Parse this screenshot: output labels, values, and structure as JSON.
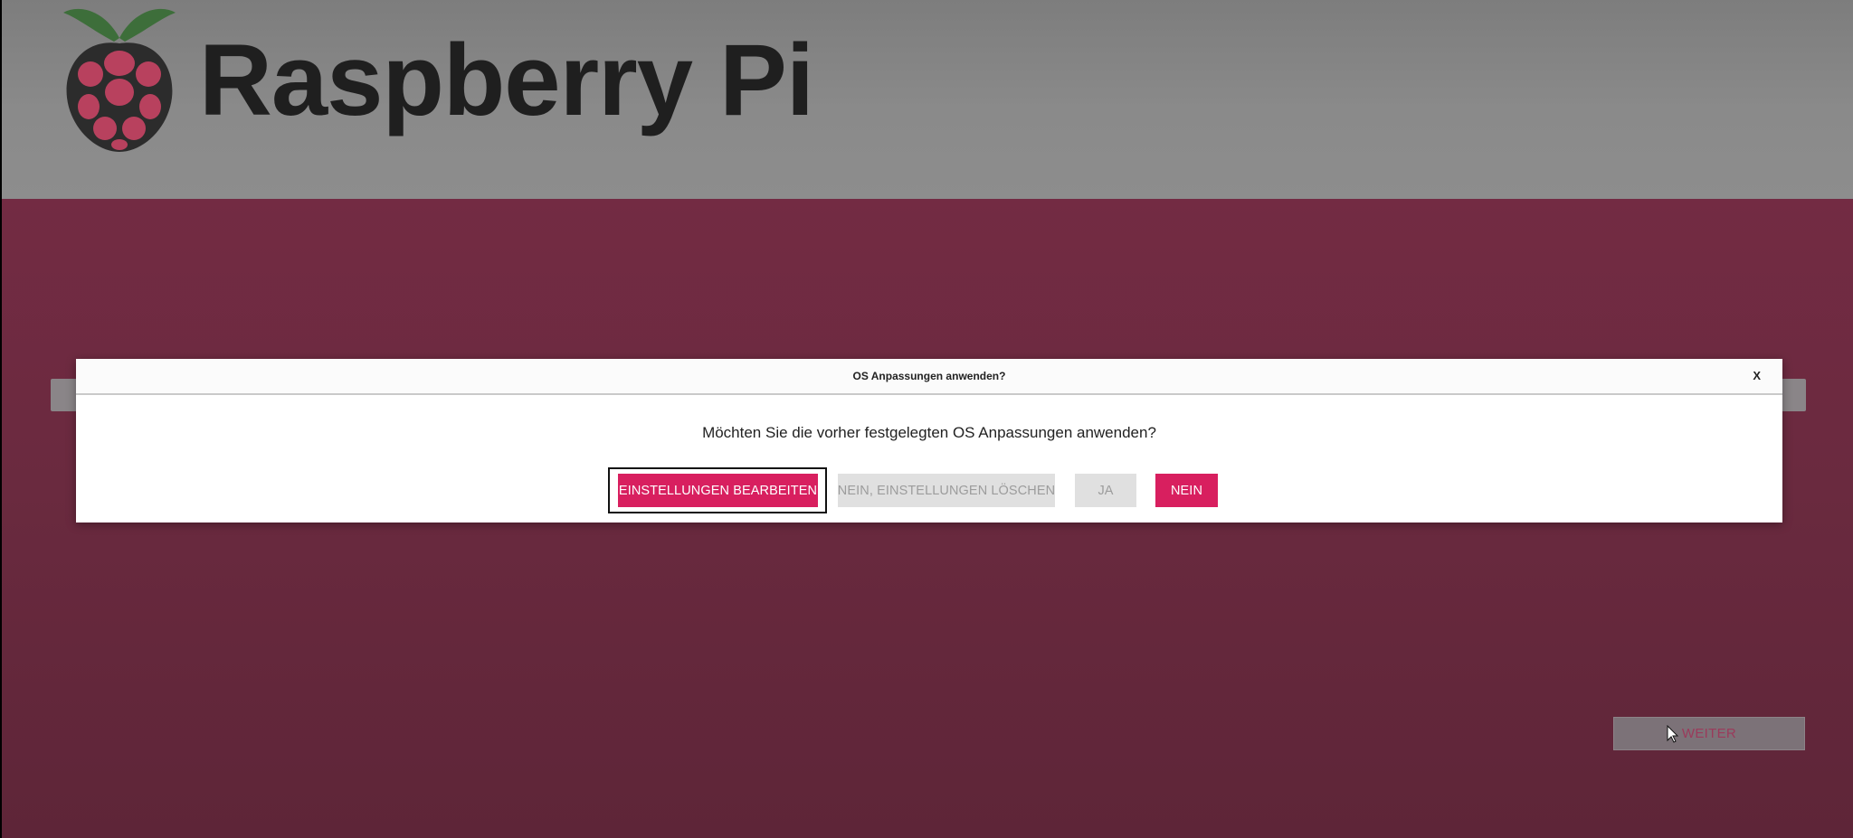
{
  "header": {
    "brand": "Raspberry Pi",
    "logo_icon": "raspberry-logo-icon"
  },
  "next_button": {
    "label": "WEITER"
  },
  "dialog": {
    "title": "OS Anpassungen anwenden?",
    "close_label": "X",
    "message": "Möchten Sie die vorher festgelegten OS Anpassungen anwenden?",
    "buttons": {
      "edit": "EINSTELLUNGEN BEARBEITEN",
      "clear": "NEIN, EINSTELLUNGEN LÖSCHEN",
      "yes": "JA",
      "no": "NEIN"
    }
  },
  "colors": {
    "primary": "#d81f5f",
    "background": "#6a2a3f",
    "header": "#8a8a8a",
    "disabled": "#e0e0e0"
  }
}
